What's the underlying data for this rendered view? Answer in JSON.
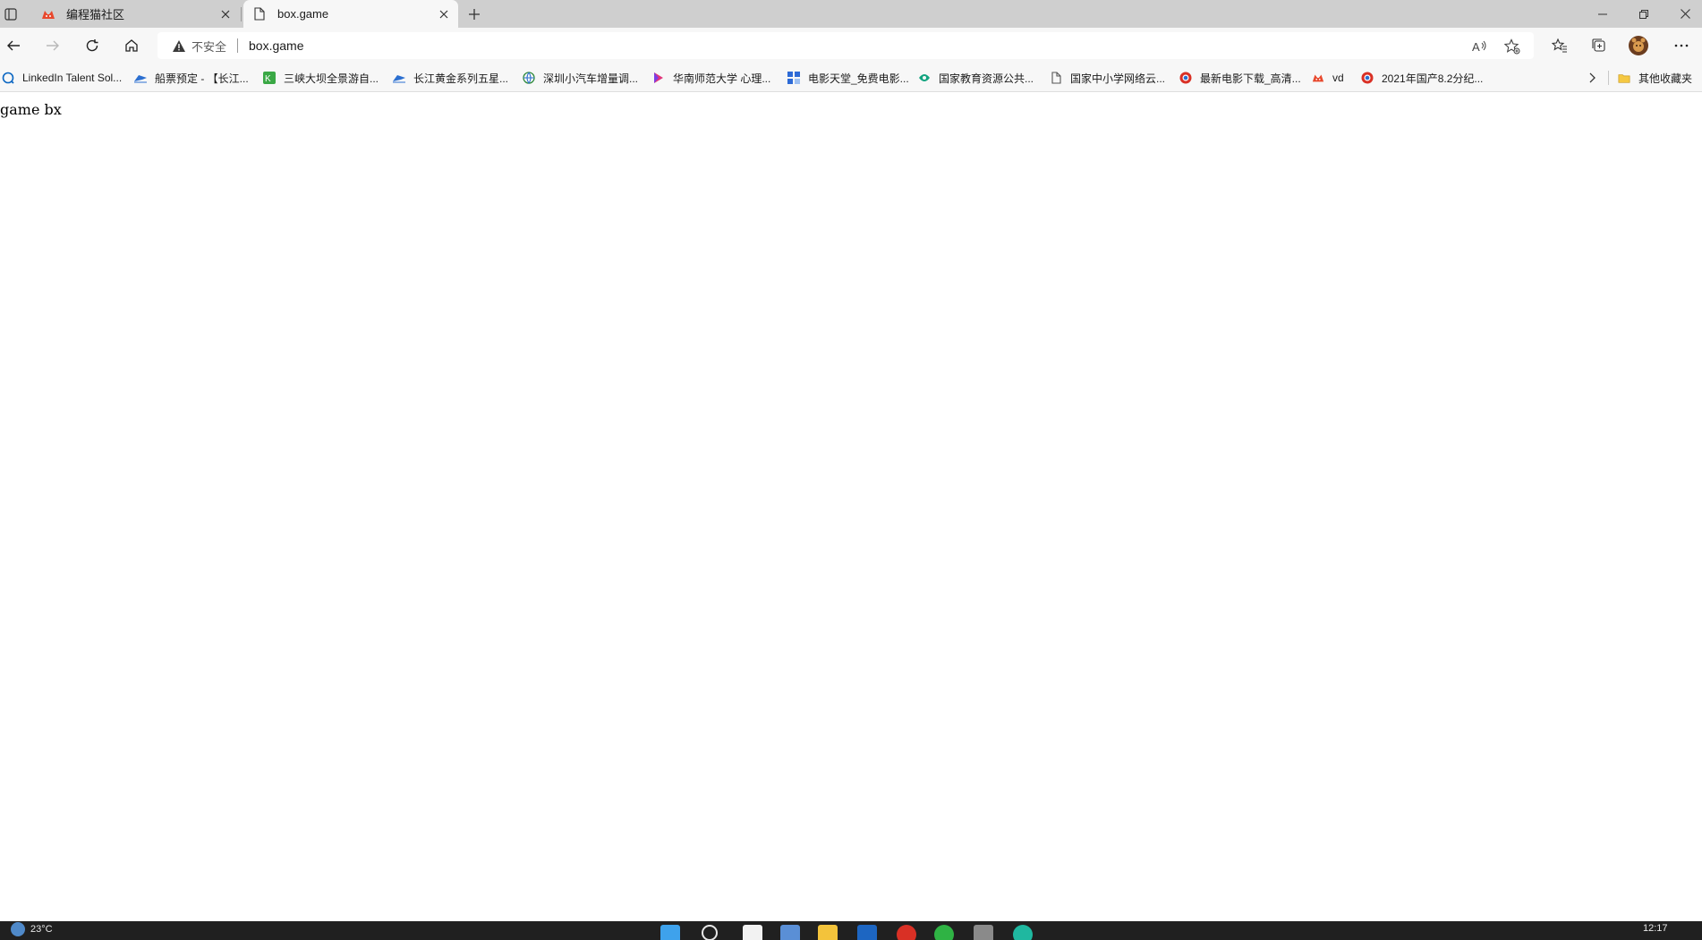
{
  "tabs": [
    {
      "title": "编程猫社区",
      "icon": "codemao-favicon",
      "active": false
    },
    {
      "title": "box.game",
      "icon": "page-icon",
      "active": true
    }
  ],
  "address_bar": {
    "security_label": "不安全",
    "url": "box.game"
  },
  "bookmarks": [
    {
      "label": "LinkedIn Talent Sol...",
      "icon": "linkedin-icon",
      "color": "#0a66c2"
    },
    {
      "label": "船票预定 - 【长江...",
      "icon": "ship-icon",
      "color": "#2b6fd0"
    },
    {
      "label": "三峡大坝全景游自...",
      "icon": "green-square-icon",
      "color": "#3aa845"
    },
    {
      "label": "长江黄金系列五星...",
      "icon": "ship-icon",
      "color": "#2b6fd0"
    },
    {
      "label": "深圳小汽车增量调...",
      "icon": "globe-icon",
      "color": "#2f8a3c"
    },
    {
      "label": "华南师范大学 心理...",
      "icon": "play-icon",
      "color": "#e2367a"
    },
    {
      "label": "电影天堂_免费电影...",
      "icon": "grid-icon",
      "color": "#2d6ad6"
    },
    {
      "label": "国家教育资源公共...",
      "icon": "leaf-icon",
      "color": "#12a37f"
    },
    {
      "label": "国家中小学网络云...",
      "icon": "page-icon",
      "color": "#555555"
    },
    {
      "label": "最新电影下载_高清...",
      "icon": "chrome-icon",
      "color": "#d93025"
    },
    {
      "label": "vd",
      "icon": "codemao-icon",
      "color": "#d93025"
    },
    {
      "label": "2021年国产8.2分纪...",
      "icon": "chrome-icon",
      "color": "#d93025"
    }
  ],
  "other_bookmarks": "其他收藏夹",
  "page": {
    "text": "game bx"
  },
  "taskbar": {
    "weather": "23°C",
    "time": "12:17"
  }
}
